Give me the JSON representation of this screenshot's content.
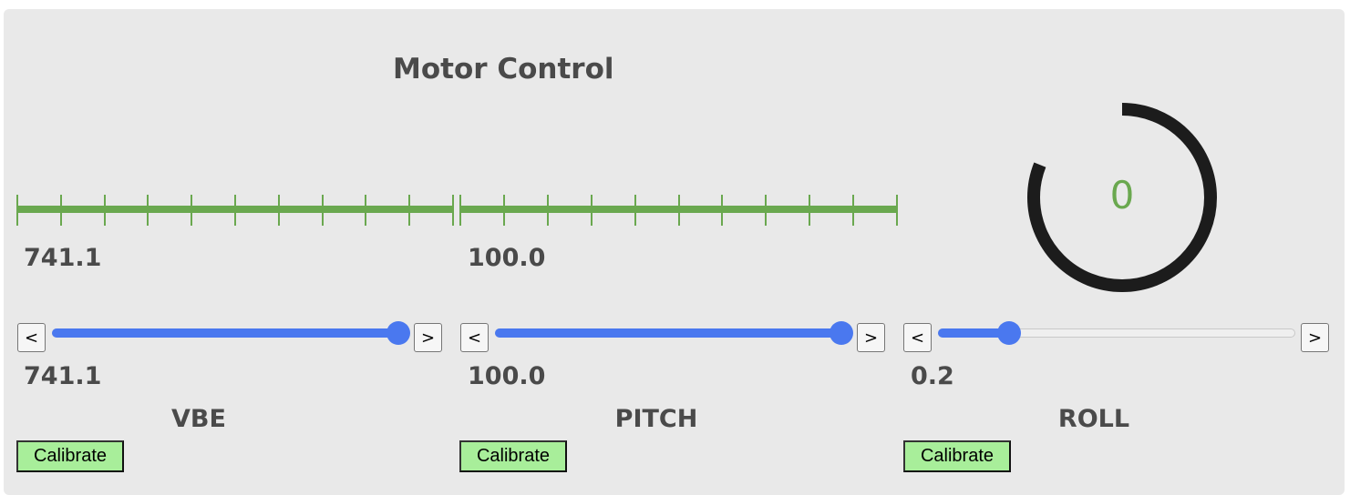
{
  "header": {
    "title": "Motor Control"
  },
  "colors": {
    "panel": "#e9e9e9",
    "meter_green": "#6aa84f",
    "slider_blue": "#4a78ef",
    "calibrate_green": "#a8ee9a",
    "gauge_dark": "#1c1c1c"
  },
  "gauge": {
    "value_label": "0",
    "fill_fraction": 0.12
  },
  "channels": [
    {
      "name": "VBE",
      "meter_value": "741.1",
      "slider_value": "741.1",
      "slider_fraction": 0.97,
      "dec_label": "<",
      "inc_label": ">",
      "calibrate_label": "Calibrate"
    },
    {
      "name": "PITCH",
      "meter_value": "100.0",
      "slider_value": "100.0",
      "slider_fraction": 0.97,
      "dec_label": "<",
      "inc_label": ">",
      "calibrate_label": "Calibrate"
    },
    {
      "name": "ROLL",
      "slider_value": "0.2",
      "slider_fraction": 0.2,
      "dec_label": "<",
      "inc_label": ">",
      "calibrate_label": "Calibrate"
    }
  ]
}
